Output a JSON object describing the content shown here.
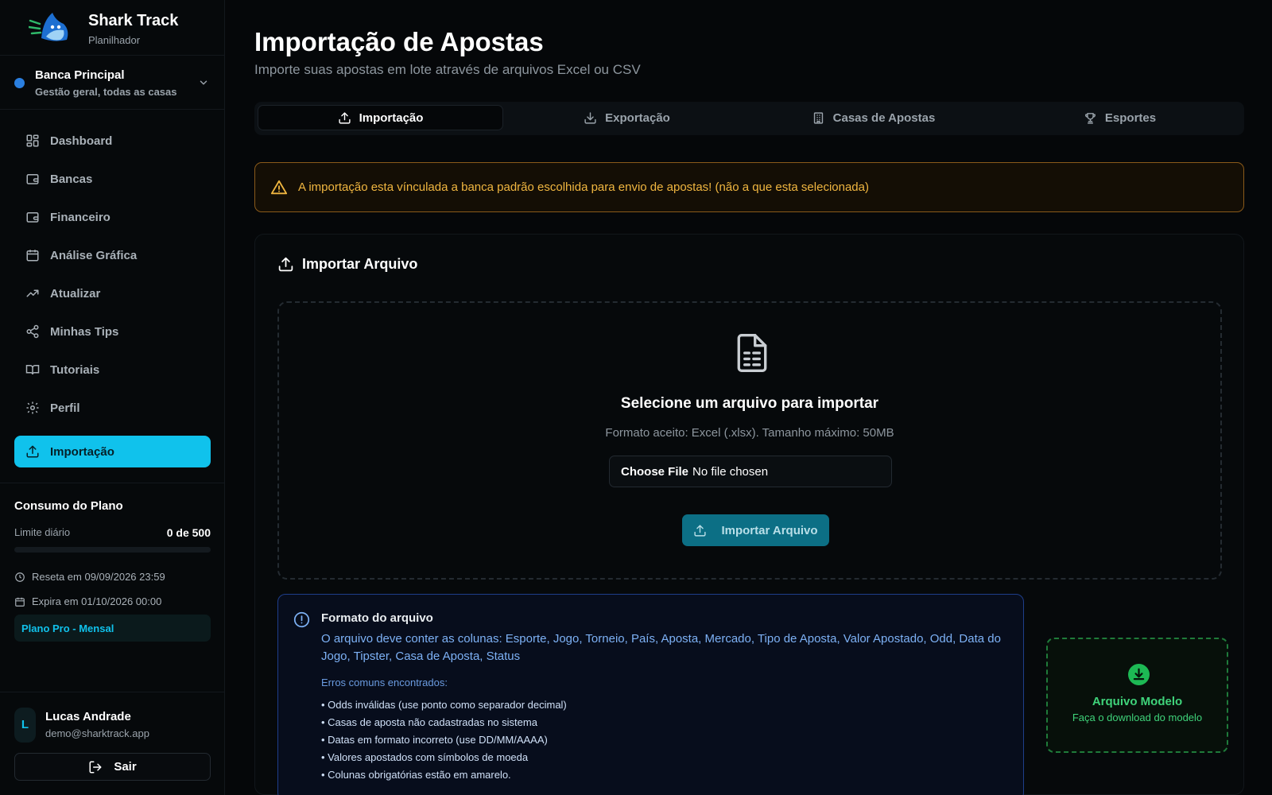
{
  "brand": {
    "title": "Shark Track",
    "subtitle": "Planilhador"
  },
  "bank": {
    "name": "Banca Principal",
    "description": "Gestão geral, todas as casas",
    "dot_color": "#2a7fe0"
  },
  "nav": [
    {
      "label": "Dashboard",
      "icon": "dashboard-icon",
      "active": false
    },
    {
      "label": "Bancas",
      "icon": "wallet-icon",
      "active": false
    },
    {
      "label": "Financeiro",
      "icon": "wallet-icon",
      "active": false
    },
    {
      "label": "Análise Gráfica",
      "icon": "calendar-icon",
      "active": false
    },
    {
      "label": "Atualizar",
      "icon": "trending-up-icon",
      "active": false
    },
    {
      "label": "Minhas Tips",
      "icon": "share-icon",
      "active": false
    },
    {
      "label": "Tutoriais",
      "icon": "book-icon",
      "active": false
    },
    {
      "label": "Perfil",
      "icon": "gear-icon",
      "active": false
    },
    {
      "label": "Importação",
      "icon": "upload-icon",
      "active": true
    }
  ],
  "plan": {
    "title": "Consumo do Plano",
    "limit_label": "Limite diário",
    "limit_value": "0 de 500",
    "usage_fraction": 0,
    "reset_text": "Reseta em 09/09/2026 23:59",
    "expire_text": "Expira em 01/10/2026 00:00",
    "badge": "Plano Pro - Mensal"
  },
  "user": {
    "initial": "L",
    "name": "Lucas Andrade",
    "email": "demo@sharktrack.app",
    "logout_label": "Sair"
  },
  "page": {
    "title": "Importação de Apostas",
    "subtitle": "Importe suas apostas em lote através de arquivos Excel ou CSV"
  },
  "tabs": [
    {
      "label": "Importação",
      "icon": "upload-icon",
      "active": true
    },
    {
      "label": "Exportação",
      "icon": "download-icon",
      "active": false
    },
    {
      "label": "Casas de Apostas",
      "icon": "building-icon",
      "active": false
    },
    {
      "label": "Esportes",
      "icon": "trophy-icon",
      "active": false
    }
  ],
  "alert": {
    "text": "A importação esta vínculada a banca padrão escolhida para envio de apostas! (não a que esta selecionada)"
  },
  "import_card": {
    "title": "Importar Arquivo",
    "drop_title": "Selecione um arquivo para importar",
    "drop_subtitle": "Formato aceito: Excel (.xlsx). Tamanho máximo: 50MB",
    "file_button": "Choose File",
    "file_status": "No file chosen",
    "submit_label": "Importar Arquivo"
  },
  "format": {
    "title": "Formato do arquivo",
    "description": "O arquivo deve conter as colunas: Esporte, Jogo, Torneio, País, Aposta, Mercado, Tipo de Aposta, Valor Apostado, Odd, Data do Jogo, Tipster, Casa de Aposta, Status",
    "errors_title": "Erros comuns encontrados:",
    "errors": [
      "• Odds inválidas (use ponto como separador decimal)",
      "• Casas de aposta não cadastradas no sistema",
      "• Datas em formato incorreto (use DD/MM/AAAA)",
      "• Valores apostados com símbolos de moeda",
      "• Colunas obrigatórias estão em amarelo."
    ]
  },
  "model": {
    "title": "Arquivo Modelo",
    "subtitle": "Faça o download do modelo"
  },
  "colors": {
    "accent": "#10c2ec",
    "warning": "#f0b640",
    "info": "#7db1f5",
    "success": "#3fd37a"
  }
}
